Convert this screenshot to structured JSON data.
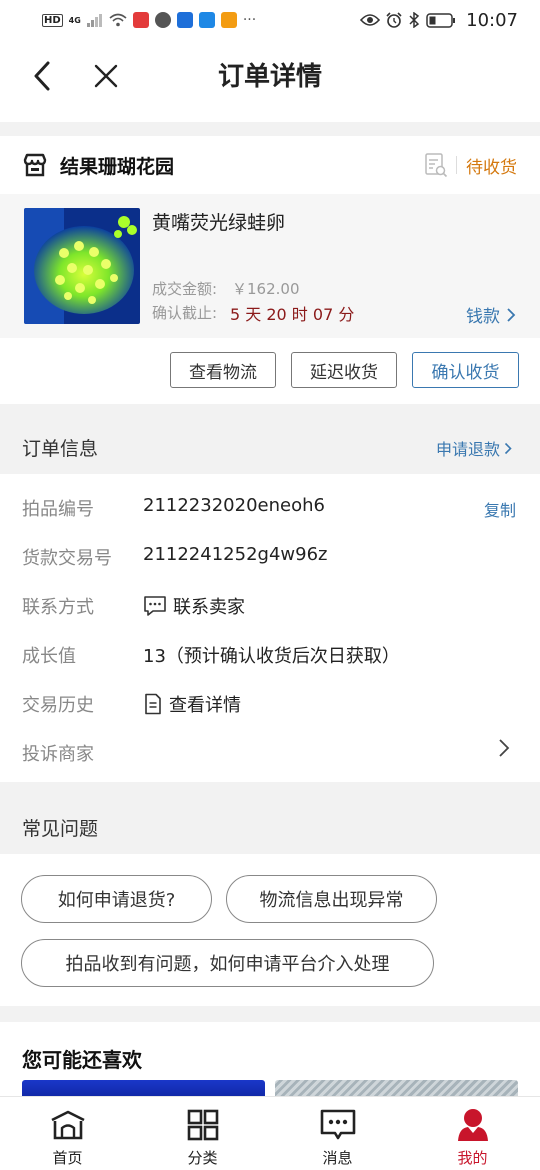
{
  "status_bar": {
    "left_labels": [
      "HD",
      "4G"
    ],
    "time": "10:07"
  },
  "nav": {
    "title": "订单详情"
  },
  "shop": {
    "name": "结果珊瑚花园",
    "status": "待收货",
    "item": {
      "title": "黄嘴荧光绿蛙卵",
      "price_label": "成交金额:",
      "price_value": "￥162.00",
      "deadline_label": "确认截止:",
      "deadline_value": "5 天 20 时 07 分",
      "money_link": "钱款"
    },
    "buttons": {
      "logistics": "查看物流",
      "delay": "延迟收货",
      "confirm": "确认收货"
    }
  },
  "order_info": {
    "title": "订单信息",
    "refund_link": "申请退款",
    "rows": [
      {
        "label": "拍品编号",
        "value": "2112232020eneoh6",
        "action": "复制"
      },
      {
        "label": "货款交易号",
        "value": "2112241252g4w96z"
      },
      {
        "label": "联系方式",
        "value": "联系卖家"
      },
      {
        "label": "成长值",
        "value": "13（预计确认收货后次日获取）"
      },
      {
        "label": "交易历史",
        "value": "查看详情"
      },
      {
        "label": "投诉商家",
        "value": ""
      }
    ]
  },
  "faq": {
    "title": "常见问题",
    "items": [
      "如何申请退货?",
      "物流信息出现异常",
      "拍品收到有问题，如何申请平台介入处理"
    ]
  },
  "recommend": {
    "title": "您可能还喜欢"
  },
  "tabbar": {
    "items": [
      {
        "label": "首页",
        "icon": "home-icon"
      },
      {
        "label": "分类",
        "icon": "category-grid-icon"
      },
      {
        "label": "消息",
        "icon": "message-icon"
      },
      {
        "label": "我的",
        "icon": "profile-icon",
        "active": true
      }
    ],
    "active_color": "#c8152b"
  },
  "colors": {
    "link_blue": "#3a78b0",
    "status_orange": "#d4780e",
    "deadline_red": "#8b1a1a"
  }
}
